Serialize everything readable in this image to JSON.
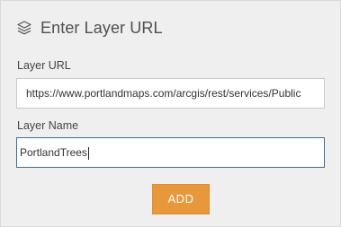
{
  "header": {
    "icon": "layers-icon",
    "title": "Enter Layer URL"
  },
  "form": {
    "url_label": "Layer URL",
    "url_value": "https://www.portlandmaps.com/arcgis/rest/services/Public",
    "name_label": "Layer Name",
    "name_value": "PortlandTrees"
  },
  "actions": {
    "add_label": "ADD"
  },
  "colors": {
    "panel_bg": "#efefef",
    "accent_button": "#e8973a",
    "focused_border": "#3b6f99"
  }
}
